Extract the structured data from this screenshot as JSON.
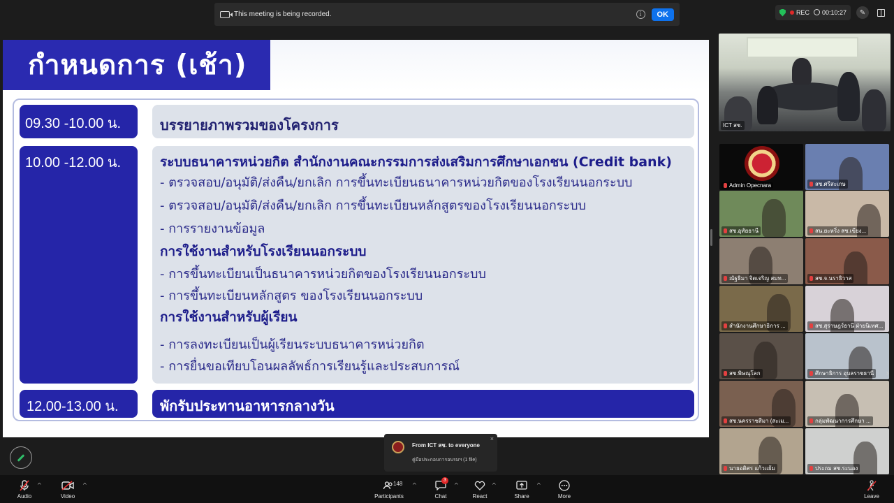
{
  "banner": {
    "message": "This meeting is being recorded.",
    "ok_label": "OK"
  },
  "status": {
    "rec_label": "REC",
    "timer": "00:10:27"
  },
  "slide": {
    "title": "กำหนดการ  (เช้า)",
    "rows": [
      {
        "time": "09.30 -10.00 น.",
        "text": "บรรยายภาพรวมของโครงการ"
      },
      {
        "time": "10.00 -12.00 น.",
        "lines": [
          {
            "kind": "heading",
            "text": "ระบบธนาคารหน่วยกิต  สำนักงานคณะกรรมการส่งเสริมการศึกษาเอกชน (Credit bank)"
          },
          {
            "kind": "item",
            "text": "- ตรวจสอบ/อนุมัติ/ส่งคืน/ยกเลิก การขึ้นทะเบียนธนาคารหน่วยกิตของโรงเรียนนอกระบบ"
          },
          {
            "kind": "item",
            "text": "- ตรวจสอบ/อนุมัติ/ส่งคืน/ยกเลิก การขึ้นทะเบียนหลักสูตรของโรงเรียนนอกระบบ"
          },
          {
            "kind": "item",
            "text": "- การรายงานข้อมูล"
          },
          {
            "kind": "heading",
            "text": "การใช้งานสำหรับโรงเรียนนอกระบบ"
          },
          {
            "kind": "item",
            "text": "- การขึ้นทะเบียนเป็นธนาคารหน่วยกิตของโรงเรียนนอกระบบ"
          },
          {
            "kind": "item",
            "text": "- การขึ้นทะเบียนหลักสูตร ของโรงเรียนนอกระบบ"
          },
          {
            "kind": "heading",
            "text": "การใช้งานสำหรับผู้เรียน"
          },
          {
            "kind": "item",
            "text": "- การลงทะเบียนเป็นผู้เรียนระบบธนาคารหน่วยกิต"
          },
          {
            "kind": "item",
            "text": "- การยื่นขอเทียบโอนผลลัพธ์การเรียนรู้และประสบการณ์"
          }
        ]
      },
      {
        "time": "12.00-13.00 น.",
        "text": "พักรับประทานอาหารกลางวัน"
      }
    ]
  },
  "gallery": {
    "main_label": "ICT สช.",
    "tiles": [
      {
        "label": "Admin Opecnara",
        "bg": "#0a0a0a"
      },
      {
        "label": "สช.ศรีสะเกษ",
        "bg": "#6a7fb0"
      },
      {
        "label": "สช.อุทัยธานี",
        "bg": "#6f8a5a"
      },
      {
        "label": "สน.ยะหริ่ง สช.เขียง...",
        "bg": "#c9b9a7"
      },
      {
        "label": "ณัฐธิมา จิตเจริญ สมท...",
        "bg": "#8d7f72"
      },
      {
        "label": "สช.จ.นราธิวาส",
        "bg": "#8a5a4a"
      },
      {
        "label": "สำนักงานศึกษาธิการ ...",
        "bg": "#7a6a4a"
      },
      {
        "label": "สช.สุราษฎร์ธานี ฝ่ายนิเทศ...",
        "bg": "#d8d2d8"
      },
      {
        "label": "สช.พิษณุโลก",
        "bg": "#5a5048"
      },
      {
        "label": "ศึกษาธิการ อุบลราชธานี",
        "bg": "#b9c2cc"
      },
      {
        "label": "สช.นครราชสีมา (สะเม...",
        "bg": "#7a6050"
      },
      {
        "label": "กลุ่มพัฒนาการศึกษา ...",
        "bg": "#c7bfb3"
      },
      {
        "label": "นายอดิศร แก้วแย้ม",
        "bg": "#b2a48f"
      },
      {
        "label": "ประถม สช.ระนอง",
        "bg": "#cfd0cf"
      }
    ]
  },
  "toolbar": {
    "audio": "Audio",
    "video": "Video",
    "participants": "Participants",
    "participants_count": "148",
    "chat": "Chat",
    "chat_badge": "3",
    "react": "React",
    "share": "Share",
    "more": "More",
    "leave": "Leave"
  },
  "chat_toast": {
    "from": "From ICT สช. to everyone",
    "message": "คู่มือประกอบการอบรมฯ (1 file)"
  }
}
